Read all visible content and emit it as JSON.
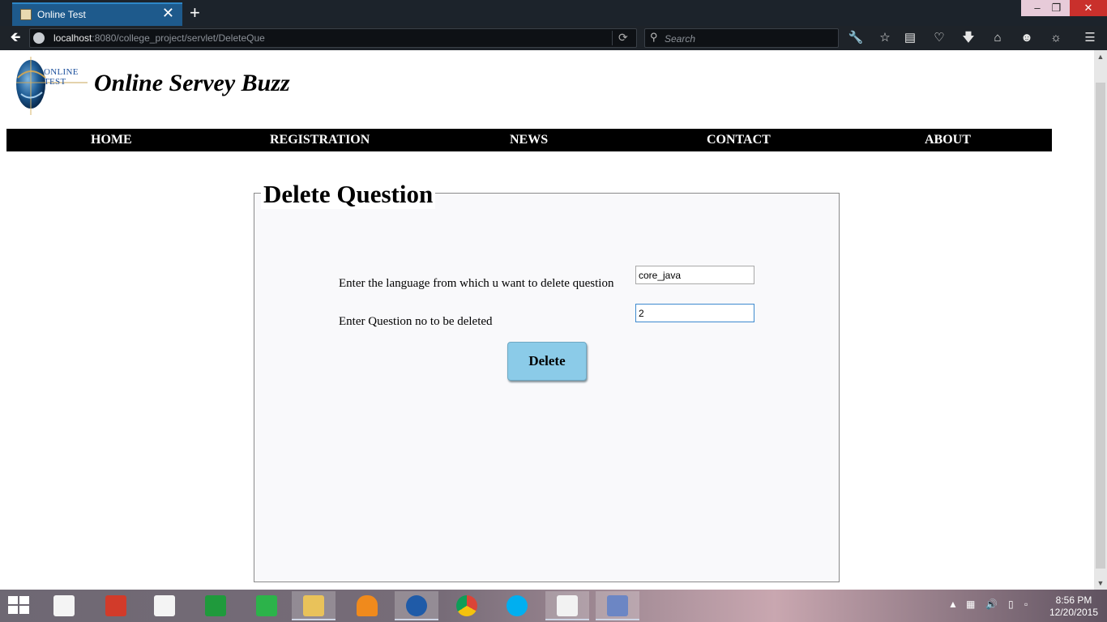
{
  "browser": {
    "tab_title": "Online Test",
    "tab_close": "✕",
    "new_tab": "+",
    "url_host": "localhost",
    "url_rest": ":8080/college_project/servlet/DeleteQue",
    "search_placeholder": "Search"
  },
  "site": {
    "logo_text": "ONLINE TEST",
    "title": "Online Servey Buzz"
  },
  "menu": {
    "home": "HOME",
    "registration": "REGISTRATION",
    "news": "NEWS",
    "contact": "CONTACT",
    "about": "ABOUT"
  },
  "form": {
    "legend": "Delete Question",
    "language_label": "Enter the language from which u want to delete question",
    "language_value": "core_java",
    "question_label": "Enter Question no to be deleted",
    "question_value": "2",
    "delete_button": "Delete"
  },
  "taskbar": {
    "time": "8:56 PM",
    "date": "12/20/2015"
  },
  "colors": {
    "menu_bg": "#000000",
    "button_bg": "#8bcbe8",
    "tab_active": "#1e5a8c"
  }
}
